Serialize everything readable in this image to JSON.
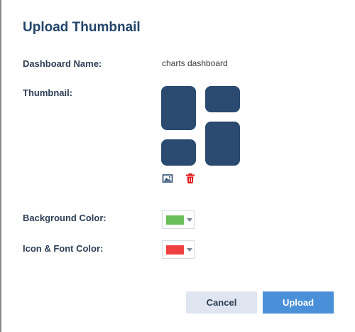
{
  "dialog": {
    "title": "Upload Thumbnail"
  },
  "fields": {
    "dashboard_name_label": "Dashboard Name:",
    "dashboard_name_value": "charts dashboard",
    "thumbnail_label": "Thumbnail:",
    "background_color_label": "Background Color:",
    "icon_font_color_label": "Icon & Font Color:"
  },
  "thumbnail": {
    "tile_color": "#2a4a70",
    "actions": {
      "image_icon": "image-icon",
      "delete_icon": "trash-icon"
    }
  },
  "colors": {
    "background_color": "#6abf5a",
    "icon_font_color": "#f04040",
    "delete_icon_color": "#e01414"
  },
  "buttons": {
    "cancel_label": "Cancel",
    "upload_label": "Upload"
  }
}
